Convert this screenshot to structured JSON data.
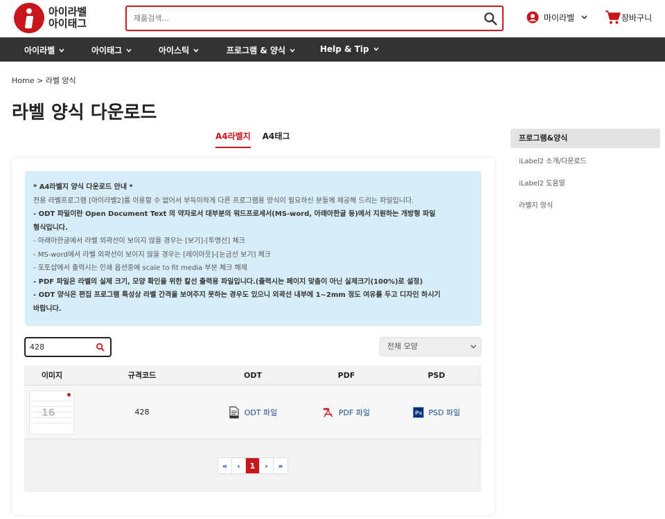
{
  "header": {
    "logo_line1": "아이라벨",
    "logo_line2": "아이태그",
    "search_placeholder": "제품검색...",
    "user_label": "마이라벨",
    "cart_label": "장바구니"
  },
  "nav": [
    {
      "label": "아이라벨"
    },
    {
      "label": "아이태그"
    },
    {
      "label": "아이스틱"
    },
    {
      "label": "프로그램 & 양식"
    },
    {
      "label": "Help & Tip"
    }
  ],
  "breadcrumb": "Home > 라벨 양식",
  "page_title": "라벨 양식 다운로드",
  "tabs": [
    {
      "label": "A4라벨지",
      "active": true
    },
    {
      "label": "A4태그",
      "active": false
    }
  ],
  "notice": {
    "title": "* A4라벨지 양식 다운로드 안내 *",
    "lines": [
      "전용 라벨프로그램 [아이라벨2]를 이용할 수 없어서 부득이하게 다른 프로그램용 양식이 필요하신 분들께 제공해 드리는 파일입니다.",
      "- ODT 파일이란 Open Document Text 의 약자로서 대부분의 워드프로세서(MS-word, 아래아한글 등)에서 지원하는 개방형 파일",
      "형식입니다.",
      "- 아래아한글에서 라벨 외곽선이 보이지 않을 경우는 [보기]-[투명선] 체크",
      "- MS-word에서 라벨 외곽선이 보이지 않을 경우는 [레이아웃]-[눈금선 보기] 체크",
      "- 포토샵에서 출력시는 인쇄 옵션중에 scale to fit media 부분 체크 해제",
      "- PDF 파일은 라벨의 실제 크기, 모양 확인을 위한 칼선 출력용 파일입니다.(출력시는 페이지 맞춤이 아닌 실제크기(100%)로 설정)",
      "- ODT 양식은 편집 프로그램 특성상 라벨 간격을 보여주지 못하는 경우도 있으니 외곽선 내부에 1~2mm 정도 여유를 두고 디자인 하시기",
      "바랍니다."
    ]
  },
  "filter": {
    "code_value": "428",
    "shape_selected": "전체 모양"
  },
  "table": {
    "headers": [
      "이미지",
      "규격코드",
      "ODT",
      "PDF",
      "PSD"
    ],
    "rows": [
      {
        "thumb_number": "16",
        "code": "428",
        "odt": "ODT 파일",
        "pdf": "PDF 파일",
        "psd": "PSD 파일"
      }
    ]
  },
  "pagination": {
    "first": "«",
    "prev": "‹",
    "current": "1",
    "next": "›",
    "last": "»"
  },
  "sidebar": {
    "heading": "프로그램&양식",
    "items": [
      {
        "label": "iLabel2 소개/다운로드"
      },
      {
        "label": "iLabel2 도움말"
      },
      {
        "label": "라벨지 양식"
      }
    ]
  },
  "colors": {
    "brand_red": "#c8161d",
    "nav_bg": "#333333",
    "notice_bg": "#d7edf7",
    "link_blue": "#1a4e8c"
  }
}
